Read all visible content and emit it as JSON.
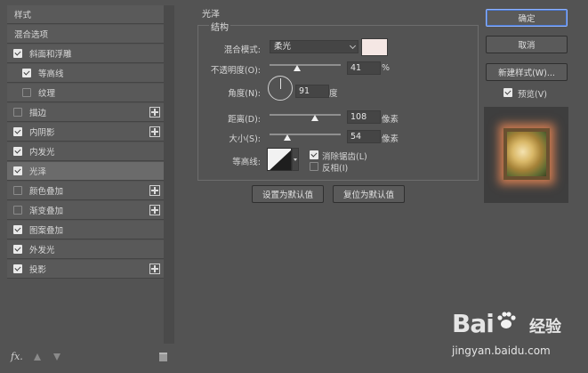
{
  "styles_panel": {
    "header": "样式",
    "blend_options": "混合选项",
    "items": [
      {
        "label": "斜面和浮雕",
        "checked": true
      },
      {
        "label": "等高线",
        "checked": true
      },
      {
        "label": "纹理",
        "checked": false
      },
      {
        "label": "描边",
        "checked": false
      },
      {
        "label": "内阴影",
        "checked": true
      },
      {
        "label": "内发光",
        "checked": true
      },
      {
        "label": "光泽",
        "checked": true
      },
      {
        "label": "颜色叠加",
        "checked": false
      },
      {
        "label": "渐变叠加",
        "checked": false
      },
      {
        "label": "图案叠加",
        "checked": true
      },
      {
        "label": "外发光",
        "checked": true
      },
      {
        "label": "投影",
        "checked": true
      }
    ],
    "fx_label": "fx."
  },
  "satin": {
    "section_title": "光泽",
    "group_title": "结构",
    "blend_mode_label": "混合模式:",
    "blend_mode_value": "柔光",
    "color_swatch": "#f5e7e4",
    "opacity_label": "不透明度(O):",
    "opacity_value": "41",
    "opacity_unit": "%",
    "angle_label": "角度(N):",
    "angle_value": "91",
    "angle_unit": "度",
    "distance_label": "距离(D):",
    "distance_value": "108",
    "distance_unit": "像素",
    "size_label": "大小(S):",
    "size_value": "54",
    "size_unit": "像素",
    "contour_label": "等高线:",
    "anti_alias_label": "消除锯齿(L)",
    "anti_alias_checked": true,
    "invert_label": "反相(I)",
    "invert_checked": false,
    "set_default_button": "设置为默认值",
    "reset_default_button": "复位为默认值"
  },
  "right_panel": {
    "ok_button": "确定",
    "cancel_button": "取消",
    "new_style_button": "新建样式(W)...",
    "preview_label": "预览(V)",
    "preview_checked": true
  },
  "watermark": {
    "logo": "Bai",
    "logo_suffix": "经验",
    "url": "jingyan.baidu.com"
  }
}
